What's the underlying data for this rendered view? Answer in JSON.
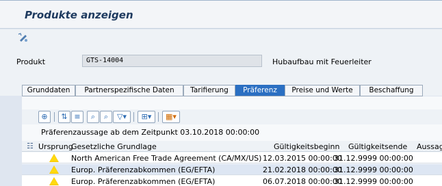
{
  "window": {
    "title": "Produkte anzeigen"
  },
  "header": {
    "field_label": "Produkt",
    "field_value": "GTS-14004",
    "field_description": "Hubaufbau mit Feuerleiter"
  },
  "tabs": [
    {
      "label": "Grunddaten",
      "active": false
    },
    {
      "label": "Partnerspezifische Daten",
      "active": false
    },
    {
      "label": "Tarifierung",
      "active": false
    },
    {
      "label": "Präferenz",
      "active": true
    },
    {
      "label": "Preise und Werte",
      "active": false
    },
    {
      "label": "Beschaffung",
      "active": false
    }
  ],
  "toolbar": {
    "icons": [
      "details-icon",
      "sort-ascending-icon",
      "filter-icon",
      "find-icon",
      "find-next-icon",
      "filter-dropdown-icon",
      "export-icon",
      "layout-icon"
    ]
  },
  "info": {
    "text": "Präferenzaussage ab dem Zeitpunkt 03.10.2018 00:00:00"
  },
  "grid": {
    "columns": [
      "Ursprung",
      "Gesetzliche Grundlage",
      "Gültigkeitsbeginn",
      "Gültigkeitsende",
      "Aussage"
    ],
    "rows": [
      {
        "status": "warning-icon",
        "basis": "North American Free Trade Agreement (CA/MX/US)",
        "start": "12.03.2015 00:00:00",
        "end": "31.12.9999 00:00:00"
      },
      {
        "status": "warning-icon",
        "basis": "Europ. Präferenzabkommen (EG/EFTA)",
        "start": "21.02.2018 00:00:00",
        "end": "31.12.9999 00:00:00"
      },
      {
        "status": "warning-icon",
        "basis": "Europ. Präferenzabkommen (EG/EFTA)",
        "start": "06.07.2018 00:00:00",
        "end": "31.12.9999 00:00:00"
      }
    ]
  },
  "colors": {
    "active_tab": "#2b6fc2",
    "selected_row": "#dde6f3",
    "warning": "#ffd90f"
  }
}
